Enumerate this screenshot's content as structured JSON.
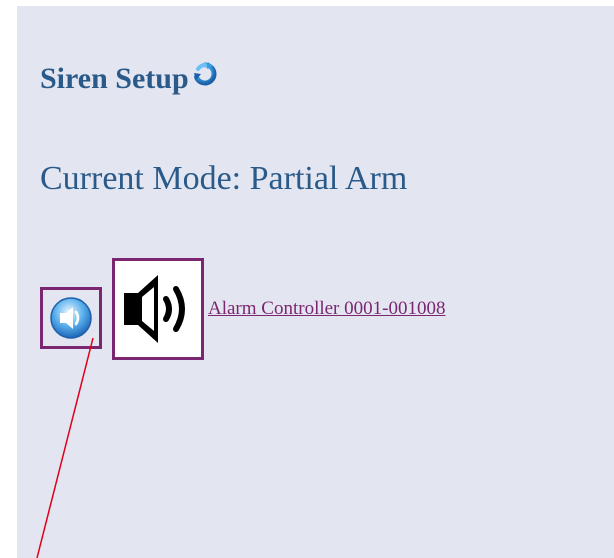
{
  "header": {
    "title": "Siren Setup",
    "refresh_icon": "refresh-icon"
  },
  "status": {
    "current_mode": "Current Mode: Partial Arm"
  },
  "siren": {
    "small_icon": "speaker-button-icon",
    "large_icon": "speaker-sound-icon",
    "controller_label": "Alarm Controller 0001-001008"
  },
  "colors": {
    "panel_background": "#e3e6f0",
    "heading_blue": "#2a5a8a",
    "link_purple": "#7a2670",
    "callout_red": "#e0001a"
  }
}
